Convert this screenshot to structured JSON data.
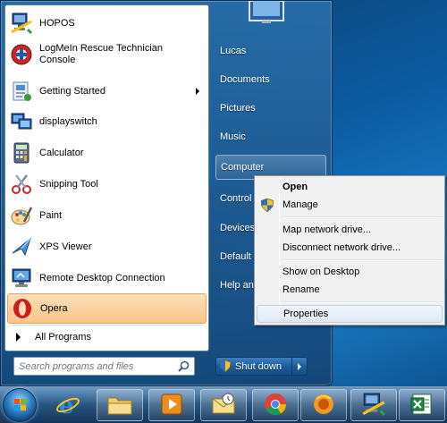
{
  "programs": [
    {
      "label": "HOPOS",
      "icon": "hopos-network-icon"
    },
    {
      "label": "LogMeIn Rescue Technician\nConsole",
      "icon": "logmein-rescue-icon"
    },
    {
      "label": "Getting Started",
      "icon": "getting-started-icon",
      "submenu": true
    },
    {
      "label": "displayswitch",
      "icon": "display-switch-icon"
    },
    {
      "label": "Calculator",
      "icon": "calculator-icon"
    },
    {
      "label": "Snipping Tool",
      "icon": "scissors-icon"
    },
    {
      "label": "Paint",
      "icon": "paint-palette-icon"
    },
    {
      "label": "XPS Viewer",
      "icon": "xps-viewer-icon"
    },
    {
      "label": "Remote Desktop Connection",
      "icon": "remote-desktop-icon"
    },
    {
      "label": "Opera",
      "icon": "opera-icon",
      "highlighted": true
    }
  ],
  "all_programs_label": "All Programs",
  "search": {
    "placeholder": "Search programs and files"
  },
  "right_pane": [
    {
      "label": "Lucas"
    },
    {
      "label": "Documents"
    },
    {
      "label": "Pictures"
    },
    {
      "label": "Music"
    },
    {
      "label": "Computer",
      "selected": true
    },
    {
      "label": "Control"
    },
    {
      "label": "Devices"
    },
    {
      "label": "Default"
    },
    {
      "label": "Help and"
    }
  ],
  "shutdown_label": "Shut down",
  "context_menu": {
    "items": [
      {
        "label": "Open",
        "bold": true
      },
      {
        "label": "Manage",
        "shield": true
      },
      {
        "label": "Map network drive..."
      },
      {
        "label": "Disconnect network drive..."
      },
      {
        "label": "Show on Desktop"
      },
      {
        "label": "Rename"
      },
      {
        "label": "Properties",
        "hover": true
      }
    ]
  },
  "taskbar": {
    "items": [
      {
        "icon": "internet-explorer-icon"
      },
      {
        "icon": "windows-explorer-icon"
      },
      {
        "icon": "media-player-icon"
      },
      {
        "icon": "outlook-icon"
      },
      {
        "icon": "chrome-icon"
      },
      {
        "icon": "firefox-icon"
      },
      {
        "icon": "hopos-network-icon"
      },
      {
        "icon": "excel-icon"
      }
    ]
  },
  "colors": {
    "highlight": "#f9c48a",
    "context_hover": "#dfe9f5",
    "start_blue": "#1d5d9c"
  }
}
